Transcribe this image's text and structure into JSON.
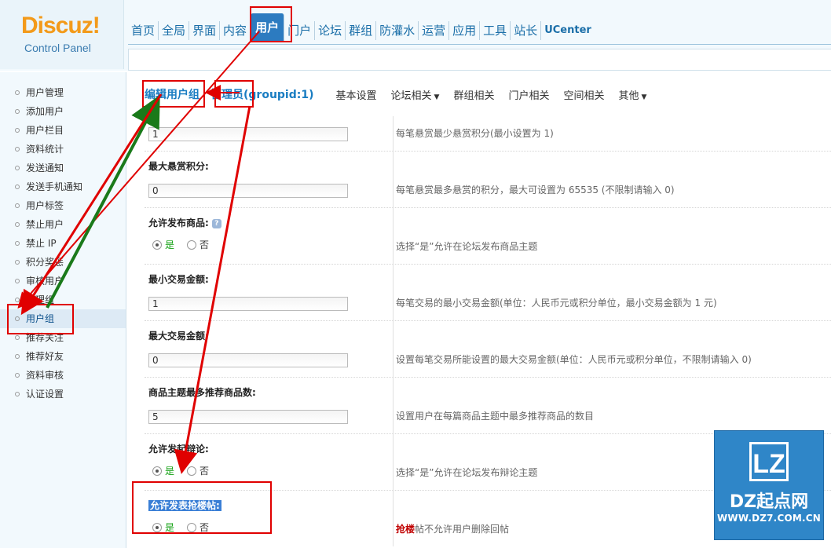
{
  "logo": {
    "main": "Discuz!",
    "sub": "Control Panel"
  },
  "topnav": {
    "items": [
      "首页",
      "全局",
      "界面",
      "内容",
      "用户",
      "门户",
      "论坛",
      "群组",
      "防灌水",
      "运营",
      "应用",
      "工具",
      "站长",
      "UCenter"
    ],
    "active": "用户"
  },
  "sidebar": {
    "items": [
      "用户管理",
      "添加用户",
      "用户栏目",
      "资料统计",
      "发送通知",
      "发送手机通知",
      "用户标签",
      "禁止用户",
      "禁止 IP",
      "积分奖惩",
      "审核用户",
      "管理组",
      "用户组",
      "推荐关注",
      "推荐好友",
      "资料审核",
      "认证设置"
    ],
    "active": "用户组"
  },
  "header": {
    "edit_title": "编辑用户组",
    "group_title": "管理员(groupid:1)",
    "tabs": [
      {
        "label": "基本设置",
        "dropdown": false
      },
      {
        "label": "论坛相关",
        "dropdown": true
      },
      {
        "label": "群组相关",
        "dropdown": false
      },
      {
        "label": "门户相关",
        "dropdown": false
      },
      {
        "label": "空间相关",
        "dropdown": false
      },
      {
        "label": "其他",
        "dropdown": true
      }
    ]
  },
  "form": {
    "row0": {
      "value": "1",
      "hint": "每笔悬赏最少悬赏积分(最小设置为 1)"
    },
    "row1": {
      "label": "最大悬赏积分:",
      "value": "0",
      "hint": "每笔悬赏最多悬赏的积分，最大可设置为 65535 (不限制请输入 0)"
    },
    "row2": {
      "label": "允许发布商品:",
      "yes": "是",
      "no": "否",
      "hint": "选择“是”允许在论坛发布商品主题"
    },
    "row3": {
      "label": "最小交易金额:",
      "value": "1",
      "hint": "每笔交易的最小交易金额(单位：人民币元或积分单位，最小交易金额为 1 元)"
    },
    "row4": {
      "label": "最大交易金额:",
      "value": "0",
      "hint": "设置每笔交易所能设置的最大交易金额(单位：人民币元或积分单位，不限制请输入 0)"
    },
    "row5": {
      "label": "商品主题最多推荐商品数:",
      "value": "5",
      "hint": "设置用户在每篇商品主题中最多推荐商品的数目"
    },
    "row6": {
      "label": "允许发起辩论:",
      "yes": "是",
      "no": "否",
      "hint": "选择“是”允许在论坛发布辩论主题"
    },
    "row7": {
      "label": "允许发表抢楼帖:",
      "yes": "是",
      "no": "否",
      "hint_strong": "抢楼",
      "hint": "帖不允许用户删除回帖"
    }
  },
  "badge": {
    "logo": "LZ",
    "name": "DZ起点网",
    "url": "WWW.DZ7.COM.CN"
  },
  "colors": {
    "annotation_red": "#e00000",
    "annotation_green": "#1a7a1a",
    "accent": "#2c7bc0"
  }
}
